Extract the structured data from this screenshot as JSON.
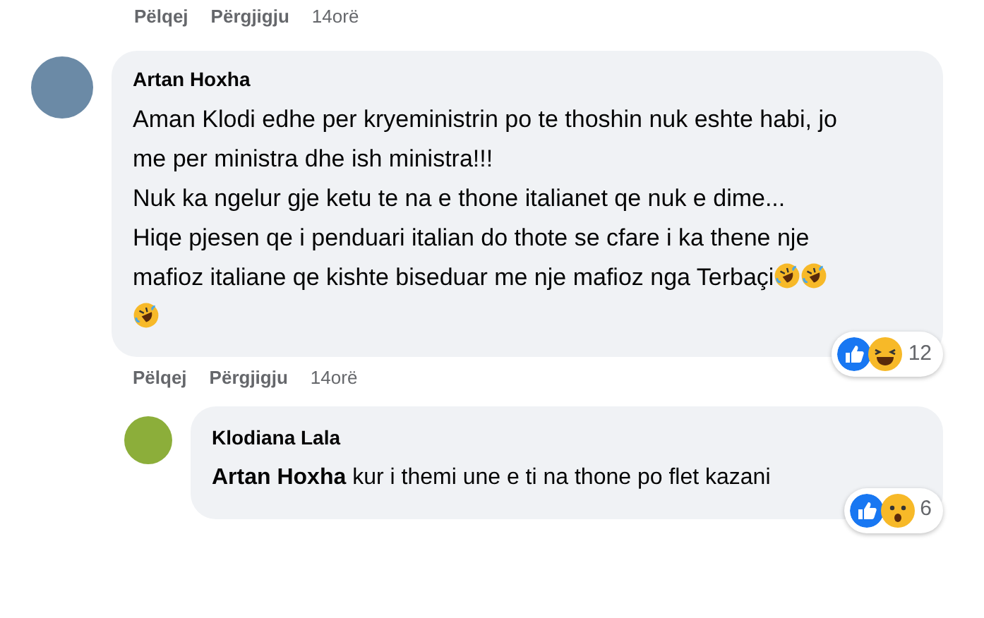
{
  "previous_actions": {
    "like": "Pëlqej",
    "reply": "Përgjigju",
    "time": "14orë"
  },
  "comments": [
    {
      "author": "Artan Hoxha",
      "paragraphs": [
        "Aman Klodi edhe per kryeministrin po te thoshin nuk eshte habi, jo me per ministra dhe ish ministra!!!",
        "Nuk ka ngelur gje ketu te na e thone italianet qe nuk e dime...",
        "Hiqe pjesen qe i penduari italian do thote se cfare i ka thene nje mafioz italiane qe kishte biseduar me nje mafioz nga Terbaçi"
      ],
      "reaction_count": "12",
      "actions": {
        "like": "Pëlqej",
        "reply": "Përgjigju",
        "time": "14orë"
      },
      "replies": [
        {
          "author": "Klodiana Lala",
          "mention": "Artan Hoxha",
          "text": "kur i themi une e ti na thone po flet kazani",
          "reaction_count": "6"
        }
      ]
    }
  ]
}
